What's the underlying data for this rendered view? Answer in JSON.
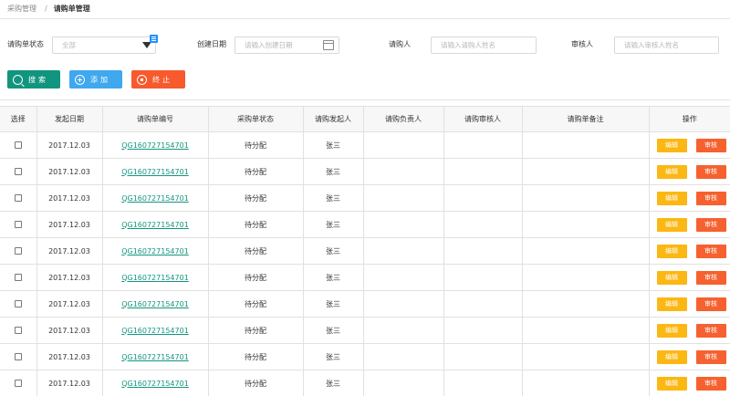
{
  "breadcrumb": {
    "parent": "采购管理",
    "separator": "/",
    "current": "请购单管理"
  },
  "filters": {
    "status": {
      "label": "请购单状态",
      "value": "全部"
    },
    "created_date": {
      "label": "创建日期",
      "placeholder": "请输入创建日期"
    },
    "requester": {
      "label": "请购人",
      "placeholder": "请输入请购人姓名"
    },
    "reviewer": {
      "label": "审核人",
      "placeholder": "请输入审核人姓名"
    }
  },
  "actions": {
    "search": "搜索",
    "add": "添加",
    "terminate": "终止"
  },
  "table": {
    "columns": [
      "选择",
      "发起日期",
      "请购单编号",
      "采购单状态",
      "请购发起人",
      "请购负责人",
      "请购审核人",
      "请购单备注",
      "操作"
    ],
    "rows": [
      {
        "date": "2017.12.03",
        "order_no": "QG160727154701",
        "status": "待分配",
        "initiator": "张三",
        "owner": "",
        "reviewer": "",
        "remark": ""
      },
      {
        "date": "2017.12.03",
        "order_no": "QG160727154701",
        "status": "待分配",
        "initiator": "张三",
        "owner": "",
        "reviewer": "",
        "remark": ""
      },
      {
        "date": "2017.12.03",
        "order_no": "QG160727154701",
        "status": "待分配",
        "initiator": "张三",
        "owner": "",
        "reviewer": "",
        "remark": ""
      },
      {
        "date": "2017.12.03",
        "order_no": "QG160727154701",
        "status": "待分配",
        "initiator": "张三",
        "owner": "",
        "reviewer": "",
        "remark": ""
      },
      {
        "date": "2017.12.03",
        "order_no": "QG160727154701",
        "status": "待分配",
        "initiator": "张三",
        "owner": "",
        "reviewer": "",
        "remark": ""
      },
      {
        "date": "2017.12.03",
        "order_no": "QG160727154701",
        "status": "待分配",
        "initiator": "张三",
        "owner": "",
        "reviewer": "",
        "remark": ""
      },
      {
        "date": "2017.12.03",
        "order_no": "QG160727154701",
        "status": "待分配",
        "initiator": "张三",
        "owner": "",
        "reviewer": "",
        "remark": ""
      },
      {
        "date": "2017.12.03",
        "order_no": "QG160727154701",
        "status": "待分配",
        "initiator": "张三",
        "owner": "",
        "reviewer": "",
        "remark": ""
      },
      {
        "date": "2017.12.03",
        "order_no": "QG160727154701",
        "status": "待分配",
        "initiator": "张三",
        "owner": "",
        "reviewer": "",
        "remark": ""
      },
      {
        "date": "2017.12.03",
        "order_no": "QG160727154701",
        "status": "待分配",
        "initiator": "张三",
        "owner": "",
        "reviewer": "",
        "remark": ""
      }
    ],
    "row_actions": {
      "edit": "编辑",
      "audit": "审核"
    }
  },
  "colors": {
    "search": "#12957f",
    "add": "#3fa8ee",
    "terminate": "#f75a2d",
    "edit": "#fbb713",
    "audit": "#f6612f",
    "link": "#12957f"
  },
  "icons": {
    "search": "search-icon",
    "add": "plus-circle-icon",
    "terminate": "stop-circle-icon",
    "dropdown": "caret-down-icon",
    "menu": "list-menu-icon",
    "calendar": "calendar-icon"
  }
}
